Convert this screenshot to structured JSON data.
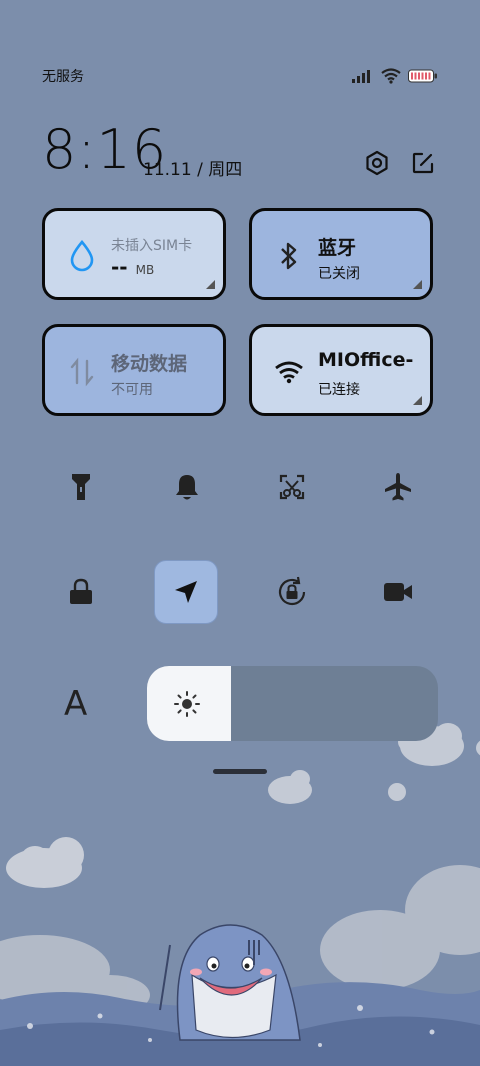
{
  "status_bar": {
    "carrier": "无服务",
    "icons": [
      "signal-icon",
      "wifi-icon",
      "battery-icon"
    ]
  },
  "header": {
    "time": "8:16",
    "date": "11.11 / 周四",
    "icons": [
      "settings-icon",
      "edit-icon"
    ]
  },
  "tiles": {
    "data_usage": {
      "label": "未插入SIM卡",
      "value": "--",
      "unit": "MB",
      "icon": "water-drop-icon"
    },
    "bluetooth": {
      "label": "蓝牙",
      "status": "已关闭",
      "icon": "bluetooth-icon"
    },
    "mobile_data": {
      "label": "移动数据",
      "status": "不可用",
      "icon": "data-arrows-icon"
    },
    "wifi": {
      "label": "MIOffice-",
      "status": "已连接",
      "icon": "wifi-icon"
    }
  },
  "quick_settings": {
    "row1": [
      "flashlight-icon",
      "bell-icon",
      "screenshot-icon",
      "airplane-icon"
    ],
    "row2": [
      "lock-icon",
      "location-icon",
      "rotation-lock-icon",
      "video-camera-icon"
    ],
    "active": "location-icon"
  },
  "brightness": {
    "level": 0.29,
    "icon": "sun-icon"
  },
  "font_size": {
    "label": "A"
  },
  "colors": {
    "background": "#7c8eab",
    "tile_light": "#c9d7ec",
    "tile_blue": "#9db5de",
    "accent": "#2196f3"
  }
}
